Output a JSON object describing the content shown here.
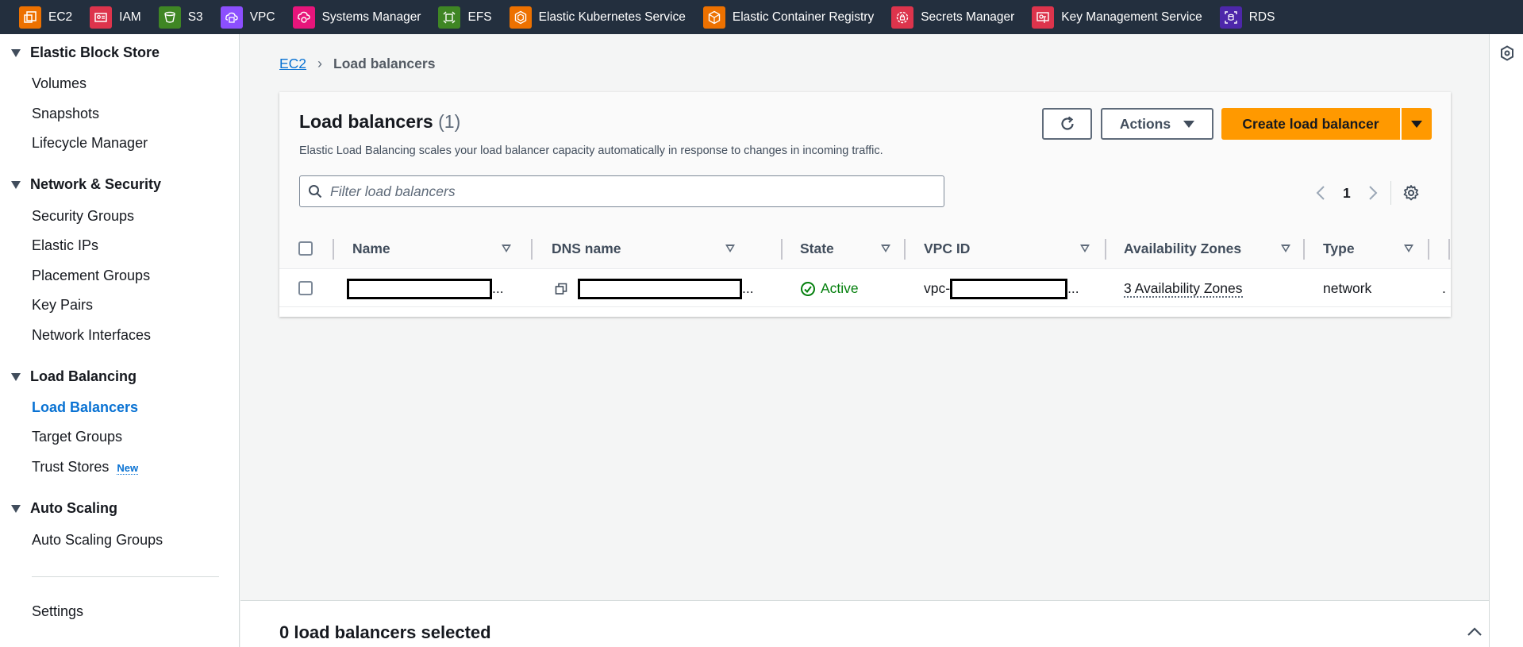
{
  "topnav": {
    "services": [
      {
        "label": "EC2",
        "icon": "ec2-icon",
        "color": "#ed7100"
      },
      {
        "label": "IAM",
        "icon": "iam-icon",
        "color": "#dd344c"
      },
      {
        "label": "S3",
        "icon": "s3-icon",
        "color": "#3f8624"
      },
      {
        "label": "VPC",
        "icon": "vpc-icon",
        "color": "#8c4fff"
      },
      {
        "label": "Systems Manager",
        "icon": "systems-manager-icon",
        "color": "#e7157b"
      },
      {
        "label": "EFS",
        "icon": "efs-icon",
        "color": "#3f8624"
      },
      {
        "label": "Elastic Kubernetes Service",
        "icon": "eks-icon",
        "color": "#ed7100"
      },
      {
        "label": "Elastic Container Registry",
        "icon": "ecr-icon",
        "color": "#ed7100"
      },
      {
        "label": "Secrets Manager",
        "icon": "secrets-manager-icon",
        "color": "#dd344c"
      },
      {
        "label": "Key Management Service",
        "icon": "kms-icon",
        "color": "#dd344c"
      },
      {
        "label": "RDS",
        "icon": "rds-icon",
        "color": "#4d27aa"
      }
    ]
  },
  "sidebar": {
    "sections": [
      {
        "title": "Elastic Block Store",
        "items": [
          "Volumes",
          "Snapshots",
          "Lifecycle Manager"
        ]
      },
      {
        "title": "Network & Security",
        "items": [
          "Security Groups",
          "Elastic IPs",
          "Placement Groups",
          "Key Pairs",
          "Network Interfaces"
        ]
      },
      {
        "title": "Load Balancing",
        "items": [
          "Load Balancers",
          "Target Groups",
          "Trust Stores"
        ]
      },
      {
        "title": "Auto Scaling",
        "items": [
          "Auto Scaling Groups"
        ]
      }
    ],
    "new_badge": "New",
    "settings": "Settings"
  },
  "breadcrumb": {
    "root": "EC2",
    "current": "Load balancers"
  },
  "panel": {
    "title": "Load balancers",
    "count": "(1)",
    "description": "Elastic Load Balancing scales your load balancer capacity automatically in response to changes in incoming traffic.",
    "actions_label": "Actions",
    "create_label": "Create load balancer",
    "search_placeholder": "Filter load balancers",
    "page": "1"
  },
  "table": {
    "columns": [
      "Name",
      "DNS name",
      "State",
      "VPC ID",
      "Availability Zones",
      "Type"
    ],
    "rows": [
      {
        "name_suffix": "...",
        "dns_suffix": "...",
        "state": "Active",
        "vpc_prefix": "vpc-",
        "vpc_suffix": "...",
        "az": "3 Availability Zones",
        "type": "network",
        "overflow": "."
      }
    ]
  },
  "split_panel": {
    "title": "0 load balancers selected"
  }
}
